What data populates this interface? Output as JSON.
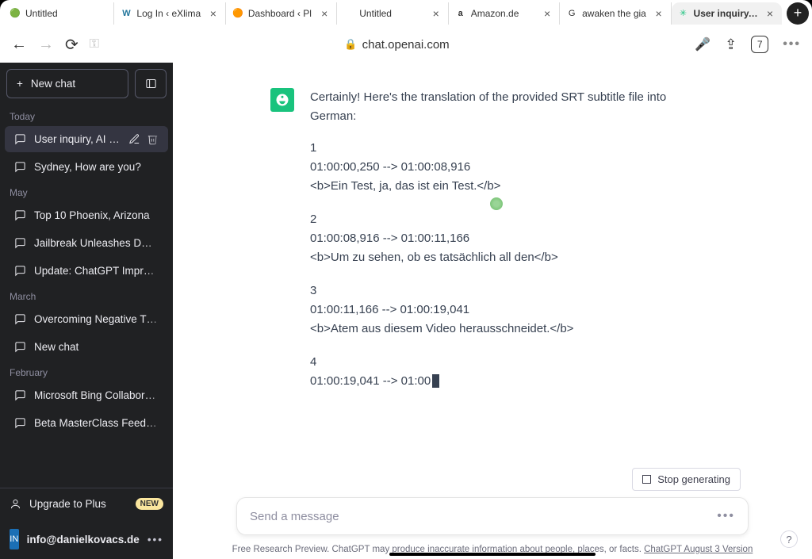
{
  "browser": {
    "tabs": [
      {
        "label": "Untitled",
        "favicon": "🟢",
        "close": true
      },
      {
        "label": "Log In ‹ eXlima",
        "favicon": "W",
        "close": true
      },
      {
        "label": "Dashboard ‹ Pl",
        "favicon": "🟠",
        "close": true
      },
      {
        "label": "Untitled",
        "favicon": "",
        "close": true
      },
      {
        "label": "Amazon.de",
        "favicon": "a",
        "close": true
      },
      {
        "label": "awaken the gia",
        "favicon": "G",
        "close": true
      },
      {
        "label": "User inquiry, A",
        "favicon": "✳",
        "close": true,
        "active": true
      }
    ],
    "url": "chat.openai.com",
    "tabcount": "7"
  },
  "sidebar": {
    "newchat": "New chat",
    "sections": {
      "today": "Today",
      "may": "May",
      "march": "March",
      "february": "February"
    },
    "conversations": {
      "c1": "User inquiry, AI response",
      "c2": "Sydney, How are you?",
      "c3": "Top 10 Phoenix, Arizona",
      "c4": "Jailbreak Unleashes DAN Power",
      "c5": "Update: ChatGPT Improvement",
      "c6": "Overcoming Negative Thought",
      "c7": "New chat",
      "c8": "Microsoft Bing Collaboration.",
      "c9": "Beta MasterClass Feedback Dis"
    },
    "upgrade": "Upgrade to Plus",
    "new_badge": "NEW",
    "account": {
      "initials": "IN",
      "email": "info@danielkovacs.de"
    }
  },
  "chat": {
    "intro": "Certainly! Here's the translation of the provided SRT subtitle file into German:",
    "blocks": [
      {
        "n": "1",
        "time": "01:00:00,250 --> 01:00:08,916",
        "text": "<b>Ein Test, ja, das ist ein Test.</b>"
      },
      {
        "n": "2",
        "time": "01:00:08,916 --> 01:00:11,166",
        "text": "<b>Um zu sehen, ob es tatsächlich all den</b>"
      },
      {
        "n": "3",
        "time": "01:00:11,166 --> 01:00:19,041",
        "text": "<b>Atem aus diesem Video herausschneidet.</b>"
      },
      {
        "n": "4",
        "time": "01:00:19,041 --> 01:00",
        "text": ""
      }
    ],
    "stop": "Stop generating",
    "placeholder": "Send a message",
    "footnote_pre": "Free Research Preview. ChatGPT may produce inaccurate information about people, places, or facts. ",
    "footnote_link": "ChatGPT August 3 Version"
  }
}
